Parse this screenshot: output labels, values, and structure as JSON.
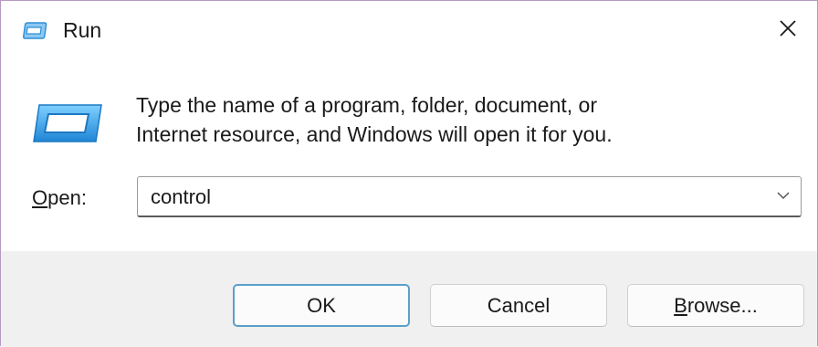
{
  "window": {
    "title": "Run",
    "close_glyph": "✕",
    "icon": "run-dialog-icon"
  },
  "content": {
    "description_line1": "Type the name of a program, folder, document, or",
    "description_line2": "Internet resource, and Windows will open it for you.",
    "open_label_mnemonic": "O",
    "open_label_rest": "pen:",
    "open_value": "control"
  },
  "buttons": {
    "ok_label": "OK",
    "cancel_label": "Cancel",
    "browse_mnemonic": "B",
    "browse_rest": "rowse..."
  },
  "colors": {
    "accent": "#5a9fc9",
    "icon_blue": "#2f8fd6",
    "footer_bg": "#f0f0f0"
  }
}
